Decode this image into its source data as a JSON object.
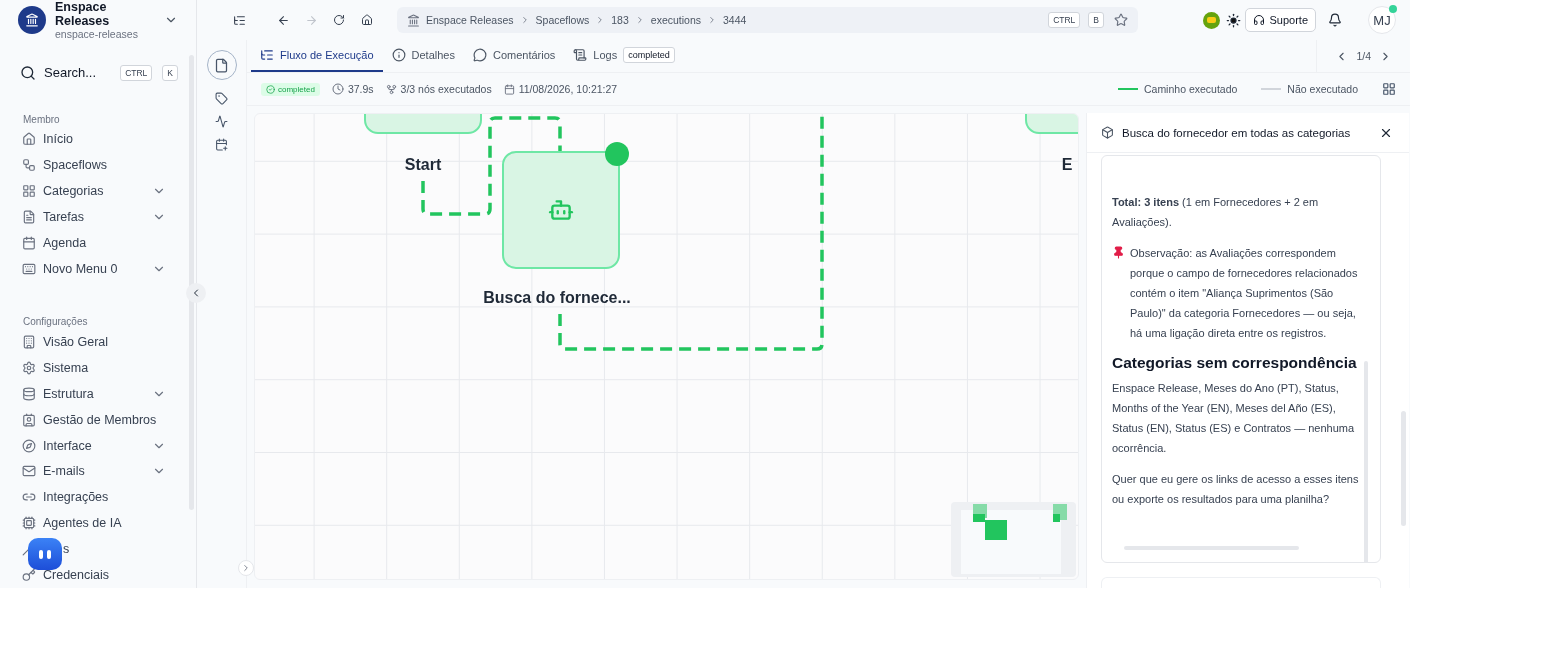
{
  "workspace": {
    "name": "Enspace Releases",
    "slug": "enspace-releases"
  },
  "search": {
    "placeholder": "Search...",
    "keys": [
      "CTRL",
      "K"
    ]
  },
  "sidebar": {
    "sections": [
      {
        "title": "Membro",
        "items": [
          {
            "label": "Início",
            "kind": "link",
            "expandable": false
          },
          {
            "label": "Spaceflows",
            "kind": "link",
            "expandable": false
          },
          {
            "label": "Categorias",
            "kind": "link",
            "expandable": true
          },
          {
            "label": "Tarefas",
            "kind": "link",
            "expandable": true
          },
          {
            "label": "Agenda",
            "kind": "link",
            "expandable": false
          },
          {
            "label": "Novo Menu 0",
            "kind": "link",
            "expandable": true
          }
        ]
      },
      {
        "title": "Configurações",
        "items": [
          {
            "label": "Visão Geral",
            "kind": "link",
            "expandable": false
          },
          {
            "label": "Sistema",
            "kind": "link",
            "expandable": false
          },
          {
            "label": "Estrutura",
            "kind": "link",
            "expandable": true
          },
          {
            "label": "Gestão de Membros",
            "kind": "link",
            "expandable": false
          },
          {
            "label": "Interface",
            "kind": "link",
            "expandable": true
          },
          {
            "label": "E-mails",
            "kind": "link",
            "expandable": true
          },
          {
            "label": "Integrações",
            "kind": "link",
            "expandable": false
          },
          {
            "label": "Agentes de IA",
            "kind": "link",
            "expandable": false
          },
          {
            "label": "s",
            "kind": "obscured",
            "expandable": false
          },
          {
            "label": "Credenciais",
            "kind": "link",
            "expandable": false
          }
        ]
      }
    ]
  },
  "breadcrumb": {
    "items": [
      "Enspace Releases",
      "Spaceflows",
      "183",
      "executions",
      "3444"
    ],
    "keys": [
      "CTRL",
      "B"
    ]
  },
  "topbar": {
    "support": "Suporte",
    "user_initials": "MJ"
  },
  "tabs": [
    {
      "label": "Fluxo de Execução",
      "selected": true
    },
    {
      "label": "Detalhes",
      "selected": false
    },
    {
      "label": "Comentários",
      "selected": false
    },
    {
      "label": "Logs",
      "selected": false,
      "badge": "completed"
    }
  ],
  "pager": "1/4",
  "stats": {
    "status": "completed",
    "duration": "37.9s",
    "nodes": "3/3 nós executados",
    "date": "11/08/2026, 10:21:27"
  },
  "legend": [
    {
      "label": "Caminho executado",
      "color": "#22c55e"
    },
    {
      "label": "Não executado",
      "color": "#d1d5db"
    }
  ],
  "canvas": {
    "nodes": [
      {
        "kind": "start",
        "label": "Start"
      },
      {
        "kind": "agent",
        "label": "Busca do fornece..."
      },
      {
        "kind": "end",
        "label": "E"
      }
    ]
  },
  "panel": {
    "title": "Busca do fornecedor em todas as categorias",
    "blocks": [
      {
        "kind": "text",
        "text": "**Total: 3 itens** (1 em Fornecedores + 2 em Avaliações)."
      },
      {
        "kind": "note",
        "text": "Observação: as Avaliações correspondem porque o campo de fornecedores relacionados contém o item \"Aliança Suprimentos (São Paulo)\" da categoria Fornecedores — ou seja, há uma ligação direta entre os registros."
      },
      {
        "kind": "heading",
        "text": "Categorias sem correspondência"
      },
      {
        "kind": "text",
        "text": "Enspace Release, Meses do Ano (PT), Status, Months of the Year (EN), Meses del Año (ES), Status (EN), Status (ES) e Contratos — nenhuma ocorrência."
      },
      {
        "kind": "text",
        "text": "Quer que eu gere os links de acesso a esses itens ou exporte os resultados para uma planilha?"
      }
    ]
  }
}
